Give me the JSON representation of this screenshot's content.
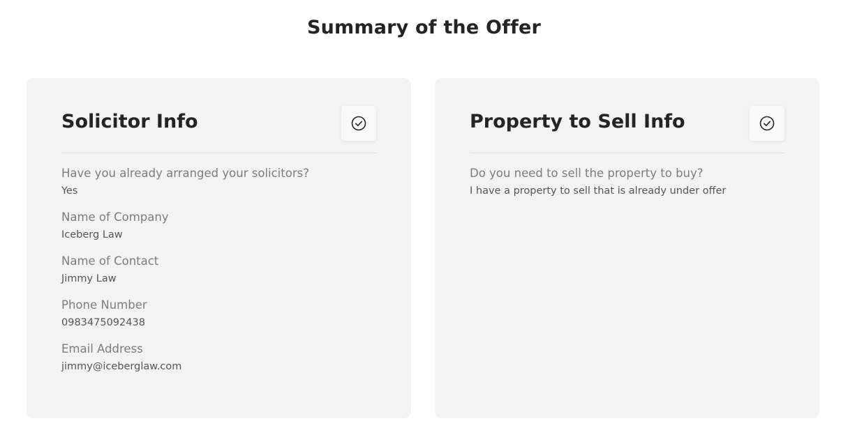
{
  "page": {
    "title": "Summary of the Offer"
  },
  "solicitor": {
    "title": "Solicitor Info",
    "check_icon": "check-circle-icon",
    "fields": [
      {
        "label": "Have you already arranged your solicitors?",
        "value": "Yes"
      },
      {
        "label": "Name of Company",
        "value": "Iceberg Law"
      },
      {
        "label": "Name of Contact",
        "value": "Jimmy Law"
      },
      {
        "label": "Phone Number",
        "value": "0983475092438"
      },
      {
        "label": "Email Address",
        "value": "jimmy@iceberglaw.com"
      }
    ]
  },
  "property": {
    "title": "Property to Sell Info",
    "check_icon": "check-circle-icon",
    "fields": [
      {
        "label": "Do you need to sell the property to buy?",
        "value": "I have a property to sell that is already under offer"
      }
    ]
  },
  "colors": {
    "card_background": "#f3f3f3",
    "title_text": "#222426",
    "label_text": "#7d7d7d",
    "value_text": "#555555"
  }
}
